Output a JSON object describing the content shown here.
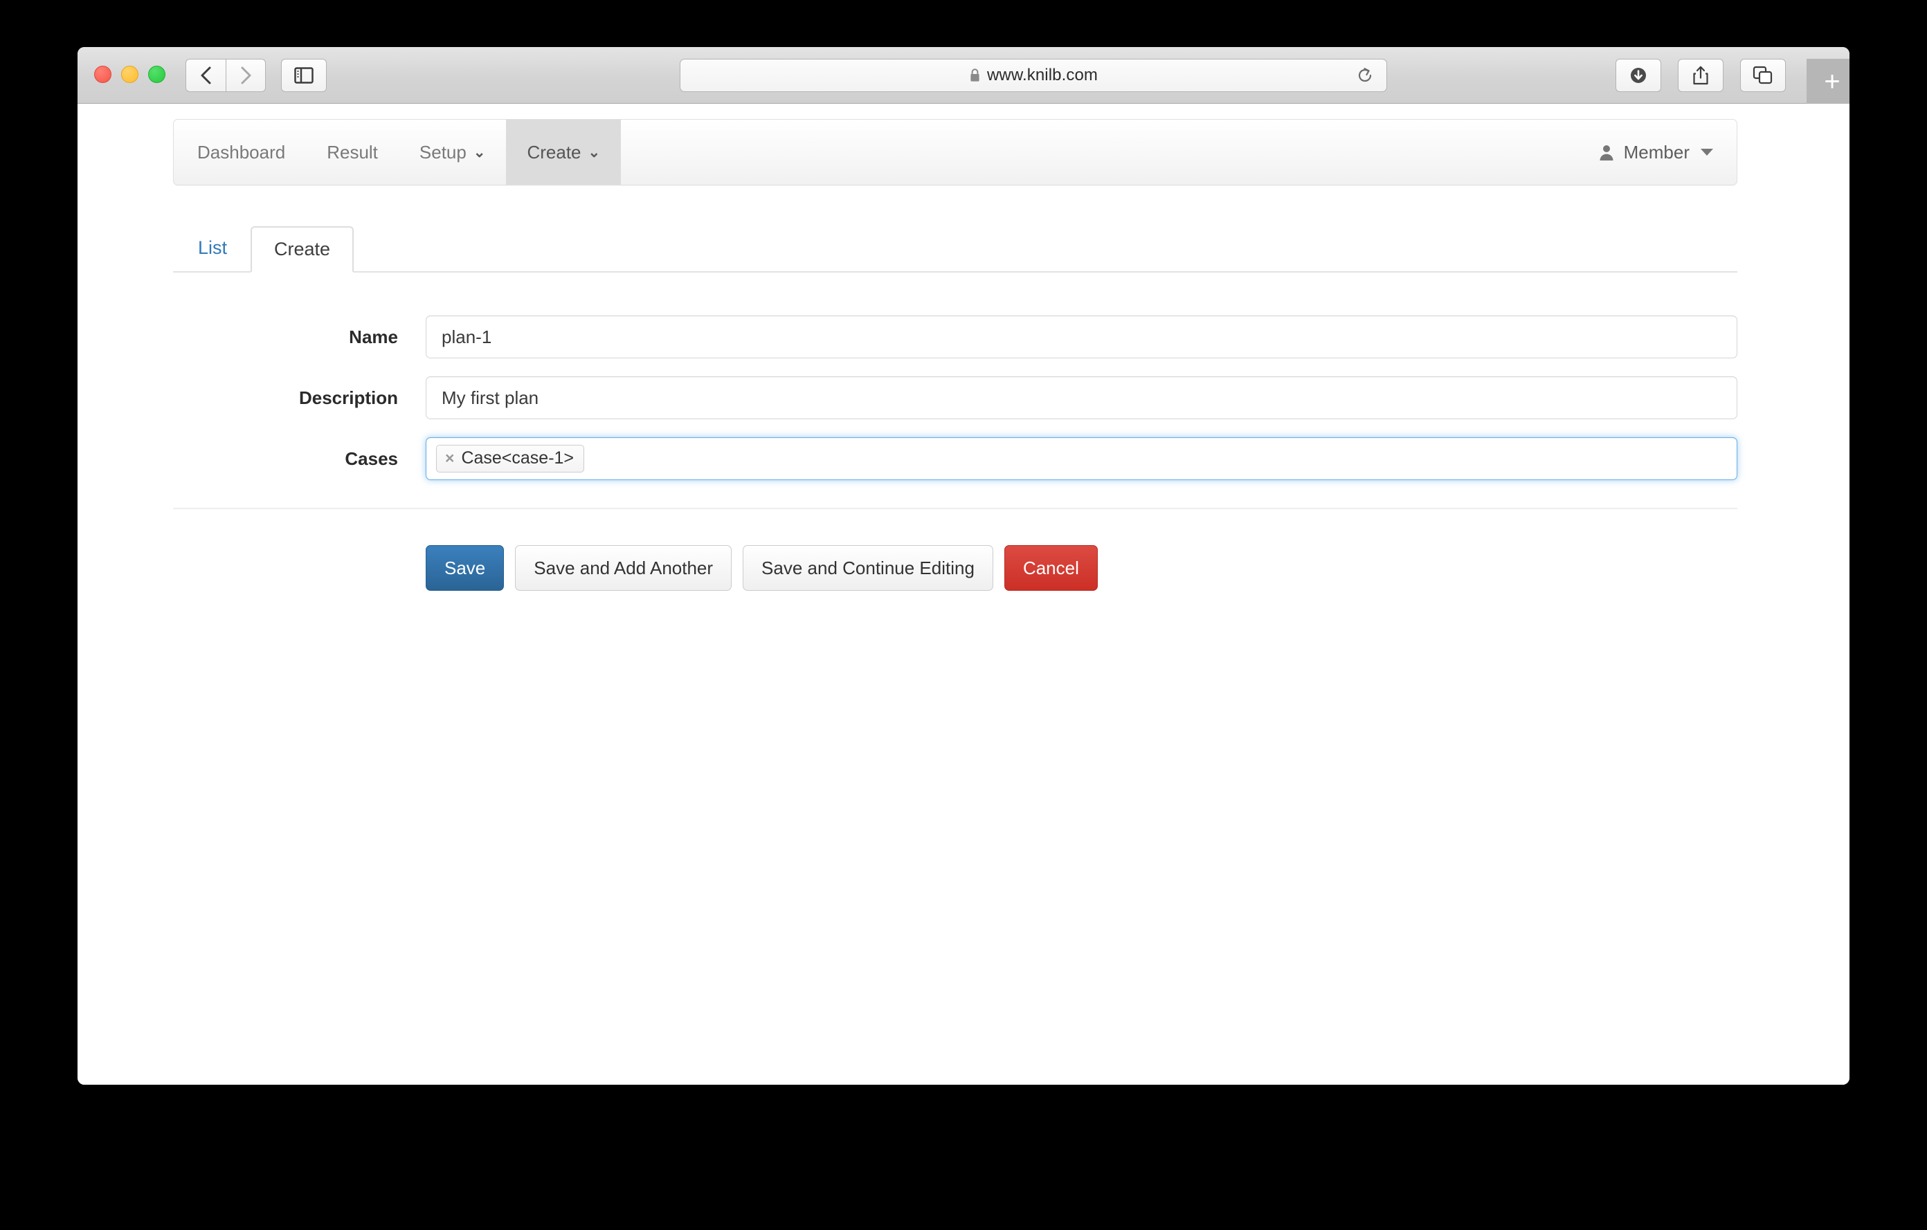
{
  "browser": {
    "url": "www.knilb.com",
    "lock_icon": "lock-icon",
    "reload_icon": "reload-icon",
    "back_icon": "chevron-left-icon",
    "forward_icon": "chevron-right-icon",
    "sidebar_icon": "sidebar-toggle-icon",
    "download_icon": "download-icon",
    "share_icon": "share-icon",
    "tabs_icon": "tab-overview-icon",
    "new_tab_label": "+",
    "traffic_lights": [
      "close-button",
      "minimize-button",
      "maximize-button"
    ]
  },
  "navbar": {
    "items": [
      {
        "label": "Dashboard",
        "has_caret": false,
        "active": false
      },
      {
        "label": "Result",
        "has_caret": false,
        "active": false
      },
      {
        "label": "Setup",
        "has_caret": true,
        "active": false
      },
      {
        "label": "Create",
        "has_caret": true,
        "active": true
      }
    ],
    "caret_glyph": "⌄",
    "user": {
      "icon": "user-icon",
      "label": "Member"
    }
  },
  "tabs": [
    {
      "label": "List",
      "active": false
    },
    {
      "label": "Create",
      "active": true
    }
  ],
  "form": {
    "fields": [
      {
        "label": "Name",
        "value": "plan-1",
        "placeholder": "",
        "type": "text"
      },
      {
        "label": "Description",
        "value": "My first plan",
        "placeholder": "",
        "type": "text"
      },
      {
        "label": "Cases",
        "type": "tags",
        "tags": [
          {
            "remove_glyph": "×",
            "label": "Case<case-1>"
          }
        ]
      }
    ]
  },
  "buttons": [
    {
      "label": "Save",
      "style": "primary"
    },
    {
      "label": "Save and Add Another",
      "style": "default"
    },
    {
      "label": "Save and Continue Editing",
      "style": "default"
    },
    {
      "label": "Cancel",
      "style": "danger"
    }
  ],
  "colors": {
    "primary": "#2a6496",
    "danger": "#cc2f26",
    "link": "#337ab7",
    "focus_ring": "#66afe9",
    "nav_active_bg": "#dcdcdc"
  }
}
